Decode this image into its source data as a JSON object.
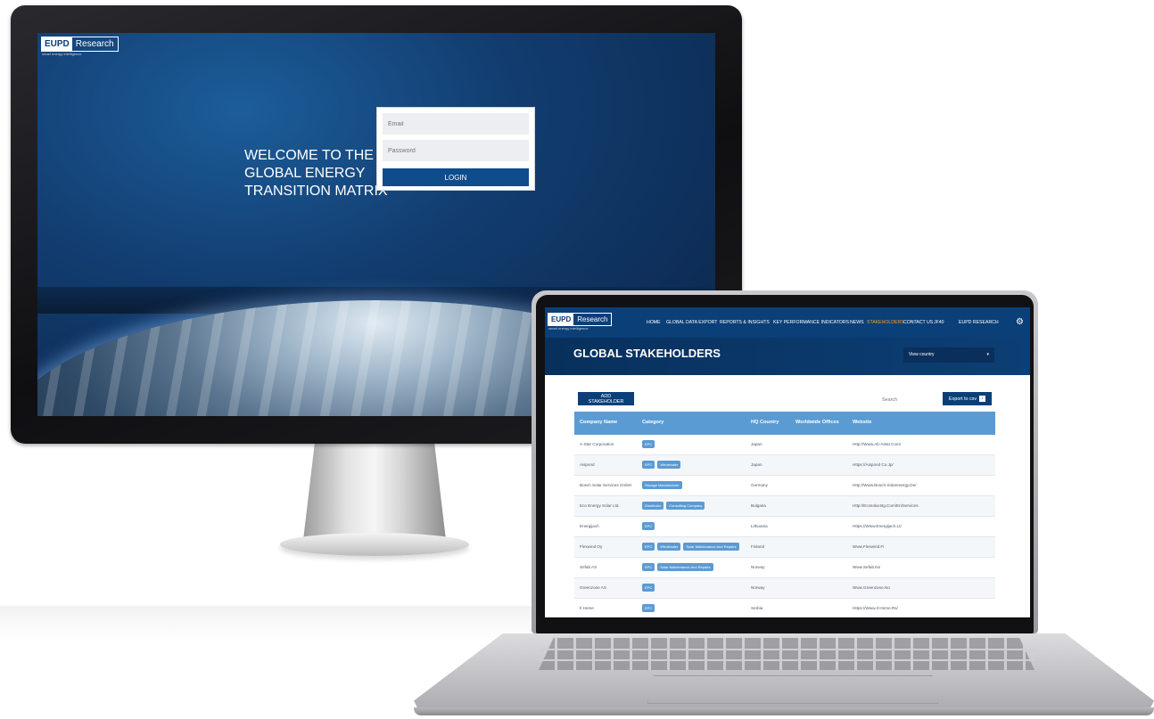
{
  "brand": {
    "eupd": "EUPD",
    "research": "Research",
    "tagline": "smart energy intelligence"
  },
  "monitor": {
    "welcome": "WELCOME TO THE GLOBAL ENERGY TRANSITION MATRIX",
    "email_placeholder": "Email",
    "password_placeholder": "Password",
    "login_label": "LOGIN"
  },
  "laptop": {
    "nav": [
      {
        "label": "HOME"
      },
      {
        "label": "GLOBAL DATA EXPORT"
      },
      {
        "label": "REPORTS & INSIGHTS"
      },
      {
        "label": "KEY PERFORMANCE INDICATORS"
      },
      {
        "label": "NEWS"
      },
      {
        "label": "STAKEHOLDERS"
      },
      {
        "label": "CONTACT US"
      },
      {
        "label": "JF40"
      },
      {
        "label": "EUPD RESEARCH"
      }
    ],
    "active_nav": "STAKEHOLDERS",
    "page_title": "GLOBAL STAKEHOLDERS",
    "country_select": "View country",
    "add_button": "ADD STAKEHOLDER",
    "search_placeholder": "Search",
    "export_button": "Export to csv",
    "columns": [
      "Company Name",
      "Category",
      "HQ Country",
      "Worldwide Offices",
      "Website"
    ],
    "rows": [
      {
        "company": "A-Star Corporation",
        "tags": [
          "EPC"
        ],
        "country": "Japan",
        "website": "Http://Www.Ab-Astar.Com/"
      },
      {
        "company": "Aispond",
        "tags": [
          "EPC",
          "Wholesaler"
        ],
        "country": "Japan",
        "website": "Https://Aispond Co.Jp/"
      },
      {
        "company": "Bosch Solar Services GmbH",
        "tags": [
          "Storage Manufacturer"
        ],
        "country": "Germany",
        "website": "Http://Www.Bosch-Solarenergy.De/"
      },
      {
        "company": "Eco Energy Solar Ltd.",
        "tags": [
          "Distributor",
          "Consulting Company"
        ],
        "country": "Bulgaria",
        "website": "Http://Ecosolar.Bg.Com/En/Services"
      },
      {
        "company": "Energijach",
        "tags": [
          "EPC"
        ],
        "country": "Lithuania",
        "website": "Https://Www.Energijach.Lt/"
      },
      {
        "company": "Flexwind Oy",
        "tags": [
          "EPC",
          "Wholesaler",
          "Solar Maintenance And Repairs"
        ],
        "country": "Finland",
        "website": "Www.Flexwind.Fi"
      },
      {
        "company": "Sefab AS",
        "tags": [
          "EPC",
          "Solar Maintenance And Repairs"
        ],
        "country": "Norway",
        "website": "Www.Sefab.No"
      },
      {
        "company": "Greenzone AS",
        "tags": [
          "EPC"
        ],
        "country": "Norway",
        "website": "Www.Greenzone.No"
      },
      {
        "company": "Il Home",
        "tags": [
          "EPC"
        ],
        "country": "Serbia",
        "website": "Https://Www.Il-Home.Rs/"
      }
    ]
  },
  "colors": {
    "navy": "#0b3f78",
    "accent": "#f3a335",
    "table_header": "#5b9bd3"
  },
  "icons": {
    "settings": "gear-icon",
    "export": "download-icon",
    "dropdown": "chevron-down-icon"
  }
}
